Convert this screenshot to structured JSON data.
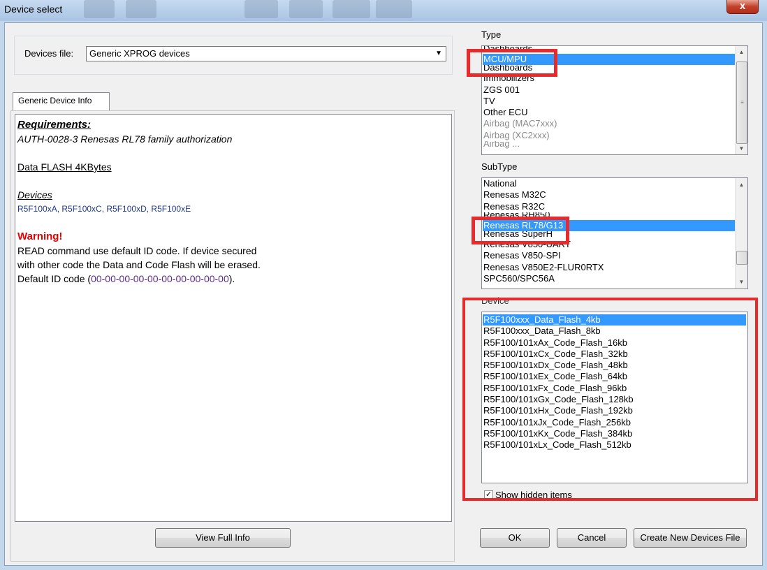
{
  "window": {
    "title": "Device select",
    "close_glyph": "x"
  },
  "devices_file": {
    "label": "Devices file:",
    "value": "Generic XPROG devices"
  },
  "info_tab": {
    "label": "Generic Device Info"
  },
  "device_info": {
    "requirements_heading": "Requirements:",
    "requirements_text": "AUTH-0028-3  Renesas RL78 family authorization",
    "data_flash": "Data FLASH 4KBytes",
    "devices_heading": "Devices",
    "devices_list": "R5F100xA, R5F100xC, R5F100xD, R5F100xE",
    "warning_heading": "Warning!",
    "warning_line1": "READ command use default ID code. If device secured",
    "warning_line2": "with other code the Data and Code Flash will be erased.",
    "default_id_prefix": "Default ID code (",
    "default_id_code": "00-00-00-00-00-00-00-00-00-00",
    "default_id_suffix": ")."
  },
  "buttons": {
    "view_full_info": "View Full Info",
    "ok": "OK",
    "cancel": "Cancel",
    "create_new": "Create New Devices File"
  },
  "type_section": {
    "label": "Type",
    "items": [
      "Dashboards ...",
      "MCU/MPU",
      "Dashboards",
      "Immobilizers",
      "ZGS 001",
      "TV",
      "Other ECU",
      "Airbag (MAC7xxx)",
      "Airbag (XC2xxx)",
      "Airbag ..."
    ],
    "selected": "MCU/MPU"
  },
  "subtype_section": {
    "label": "SubType",
    "items": [
      "National",
      "Renesas M32C",
      "Renesas R32C",
      "Renesas RH850",
      "Renesas RL78/G13",
      "Renesas SuperH",
      "Renesas V850-UART",
      "Renesas V850-SPI",
      "Renesas V850E2-FLUR0RTX",
      "SPC560/SPC56A"
    ],
    "selected": "Renesas RL78/G13"
  },
  "device_section": {
    "label": "Device",
    "items": [
      "R5F100xxx_Data_Flash_4kb",
      "R5F100xxx_Data_Flash_8kb",
      "R5F100/101xAx_Code_Flash_16kb",
      "R5F100/101xCx_Code_Flash_32kb",
      "R5F100/101xDx_Code_Flash_48kb",
      "R5F100/101xEx_Code_Flash_64kb",
      "R5F100/101xFx_Code_Flash_96kb",
      "R5F100/101xGx_Code_Flash_128kb",
      "R5F100/101xHx_Code_Flash_192kb",
      "R5F100/101xJx_Code_Flash_256kb",
      "R5F100/101xKx_Code_Flash_384kb",
      "R5F100/101xLx_Code_Flash_512kb"
    ],
    "selected": "R5F100xxx_Data_Flash_4kb"
  },
  "show_hidden": {
    "label": "Show hidden items",
    "checked": true,
    "check_glyph": "✓"
  },
  "colors": {
    "selection": "#3399ff",
    "highlight_box": "#e52b2b",
    "warning": "#e00000"
  }
}
